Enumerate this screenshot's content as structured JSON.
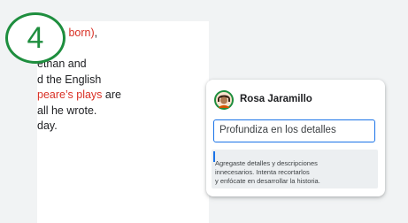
{
  "step": {
    "number": "4"
  },
  "document": {
    "lines": [
      {
        "before": "",
        "red": "peare born)",
        "after": ","
      },
      {
        "before": "",
        "red": "",
        "after": ""
      },
      {
        "before": "ethan and",
        "red": "",
        "after": ""
      },
      {
        "before": "d the English",
        "red": "",
        "after": ""
      },
      {
        "before": "",
        "red": "peare’s plays",
        "after": " are"
      },
      {
        "before": "all he wrote.",
        "red": "",
        "after": ""
      },
      {
        "before": "day.",
        "red": "",
        "after": ""
      }
    ]
  },
  "comment": {
    "author": "Rosa Jaramillo",
    "avatar_icon": "user-avatar-icon",
    "input_value": "Profundiza en los detalles",
    "suggestion_lines": [
      "Agregaste detalles y descripciones",
      "innecesarios. Intenta recortarlos",
      "y enfócate en desarrollar la historia."
    ]
  },
  "colors": {
    "accent_green": "#1e8e3e",
    "link_red": "#d93025",
    "focus_blue": "#1a73e8"
  }
}
